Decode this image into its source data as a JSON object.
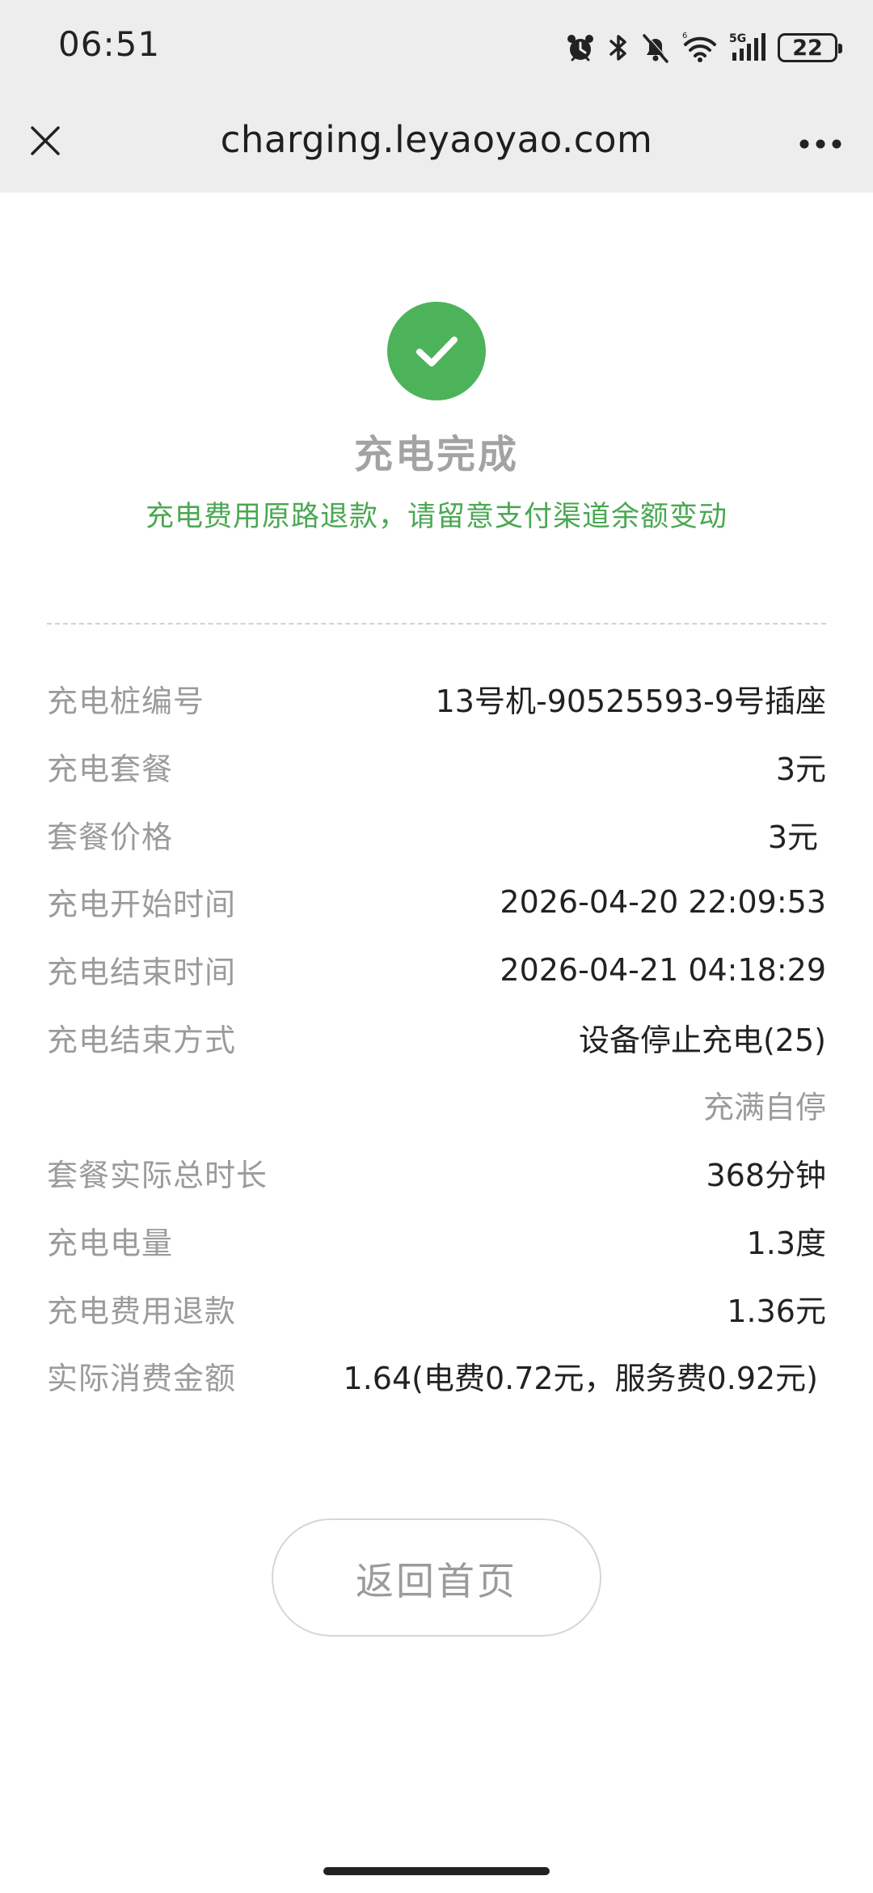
{
  "status_bar": {
    "time": "06:51",
    "icons": [
      "alarm-icon",
      "bluetooth-icon",
      "mute-icon",
      "wifi-icon",
      "signal-5g-icon",
      "battery-icon"
    ],
    "network_label": "5G",
    "battery_level": "22"
  },
  "nav": {
    "title": "charging.leyaoyao.com",
    "close_icon": "close-icon",
    "more_icon": "more-icon"
  },
  "result": {
    "icon": "check-circle-icon",
    "title": "充电完成",
    "subtitle": "充电费用原路退款，请留意支付渠道余额变动"
  },
  "colors": {
    "accent_green": "#4db35a",
    "subtitle_green": "#4aa853",
    "label_gray": "#9b9b9b",
    "topbar_bg": "#ededed"
  },
  "details": [
    {
      "label": "充电桩编号",
      "value": "13号机-90525593-9号插座"
    },
    {
      "label": "充电套餐",
      "value": "3元"
    },
    {
      "label": "套餐价格",
      "value": "3元"
    },
    {
      "label": "充电开始时间",
      "value": "2026-04-20 22:09:53"
    },
    {
      "label": "充电结束时间",
      "value": "2026-04-21 04:18:29"
    },
    {
      "label": "充电结束方式",
      "value": "设备停止充电(25)"
    },
    {
      "label": "",
      "value": "充满自停"
    },
    {
      "label": "套餐实际总时长",
      "value": "368分钟"
    },
    {
      "label": "充电电量",
      "value": "1.3度"
    },
    {
      "label": "充电费用退款",
      "value": "1.36元"
    },
    {
      "label": "实际消费金额",
      "value": "1.64(电费0.72元，服务费0.92元)"
    }
  ],
  "actions": {
    "home_button": "返回首页"
  }
}
